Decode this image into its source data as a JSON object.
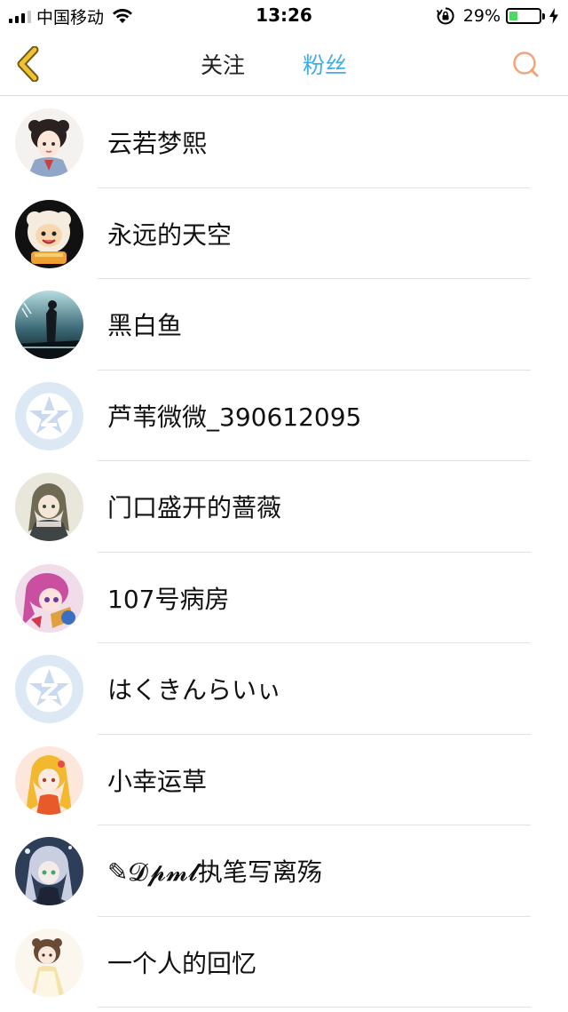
{
  "status_bar": {
    "carrier": "中国移动",
    "time": "13:26",
    "battery_percent": "29%",
    "battery_level": 0.29,
    "signal_bars": 4,
    "signal_bars_active": 3,
    "wifi_icon": "wifi-icon",
    "rotation_lock_icon": "rotation-lock-icon",
    "charging_icon": "charging-bolt-icon"
  },
  "nav": {
    "back_icon": "chevron-left-icon",
    "tabs": [
      {
        "label": "关注",
        "active": false
      },
      {
        "label": "粉丝",
        "active": true
      }
    ],
    "search_icon": "search-icon",
    "colors": {
      "active_tab": "#3eaee6",
      "back_icon": "#f2c12e",
      "search_icon": "#f3a47a"
    }
  },
  "fans": [
    {
      "name": "云若梦熙",
      "avatar": "anime-girl-hanfu"
    },
    {
      "name": "永远的天空",
      "avatar": "cartoon-sheep"
    },
    {
      "name": "黑白鱼",
      "avatar": "dark-scene"
    },
    {
      "name": "芦苇微微_390612095",
      "avatar": "default-qq"
    },
    {
      "name": "门口盛开的蔷薇",
      "avatar": "anime-girl-gray"
    },
    {
      "name": "107号病房",
      "avatar": "anime-pink-hair"
    },
    {
      "name": "はくきんらいぃ",
      "avatar": "default-qq"
    },
    {
      "name": "小幸运草",
      "avatar": "anime-yellow-hair"
    },
    {
      "name": "✎𝓓𝓹𝓶𝓵执笔写离殇",
      "avatar": "anime-silver-hair"
    },
    {
      "name": "一个人的回忆",
      "avatar": "anime-chibi-girl"
    }
  ]
}
